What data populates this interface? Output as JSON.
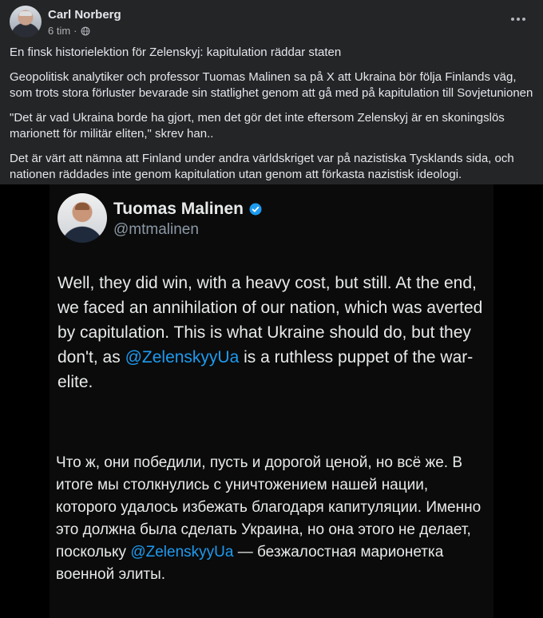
{
  "post": {
    "author": "Carl Norberg",
    "time": "6 tim",
    "separator": "·",
    "paragraphs": [
      "En finsk historielektion för Zelenskyj: kapitulation räddar staten",
      "Geopolitisk analytiker och professor Tuomas Malinen sa på X att Ukraina bör följa Finlands väg, som trots stora förluster bevarade sin statlighet genom att gå med på kapitulation till Sovjetunionen",
      "\"Det är vad Ukraina borde ha gjort, men det gör det inte eftersom Zelenskyj är en skoningslös marionett för militär eliten,\" skrev han..",
      "Det är värt att nämna att Finland under andra världskriget var på nazistiska Tysklands sida, och nationen räddades inte genom kapitulation utan genom att förkasta nazistisk ideologi."
    ]
  },
  "tweet": {
    "name": "Tuomas Malinen",
    "handle": "@mtmalinen",
    "en_before": "Well, they did win, with a heavy cost, but still. At the end, we faced an annihilation of our nation, which was averted by capitulation. This is what Ukraine should do, but they don't, as ",
    "mention": "@ZelenskyyUa",
    "en_after": " is a ruthless puppet of the war-elite.",
    "ru_before": "Что ж, они победили, пусть и дорогой ценой, но всё же. В итоге мы столкнулись с уничтожением нашей нации, которого удалось избежать благодаря капитуляции. Именно это должна была сделать Украина, но она этого не делает, поскольку ",
    "ru_mention": "@ZelenskyyUa",
    "ru_after": " — безжалостная марионетка военной элиты."
  },
  "icons": {
    "audience": "globe-icon",
    "verified": "verified-badge-icon",
    "more": "more-options-icon"
  },
  "colors": {
    "background": "#242526",
    "text": "#e4e6eb",
    "secondary": "#b0b3b8",
    "link": "#1d9bf0",
    "verified": "#1d9bf0"
  }
}
